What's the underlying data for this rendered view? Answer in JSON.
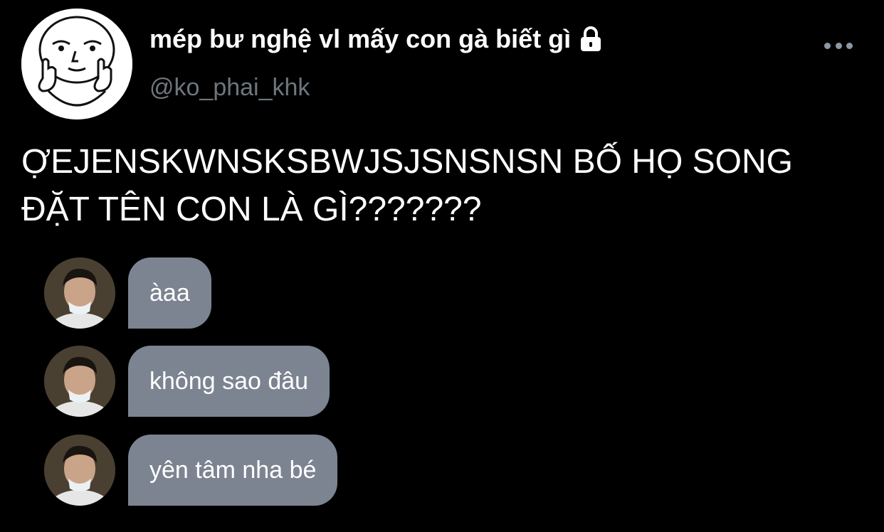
{
  "profile": {
    "display_name": "mép bư nghệ vl mấy con gà biết gì",
    "handle": "@ko_phai_khk",
    "avatar_icon": "meme-face-middle-fingers-avatar",
    "lock_icon": "lock-icon",
    "more_icon": "more-options-icon"
  },
  "tweet": {
    "text_line1": "ỢEJENSKWNSKSBWJSJSNSNSN BỐ HỌ SONG",
    "text_line2": "ĐẶT TÊN CON LÀ GÌ???????"
  },
  "chat": {
    "bubble_color": "#7c8491",
    "messages": [
      {
        "text": "àaa"
      },
      {
        "text": "không sao đâu"
      },
      {
        "text": "yên tâm nha bé"
      }
    ]
  }
}
